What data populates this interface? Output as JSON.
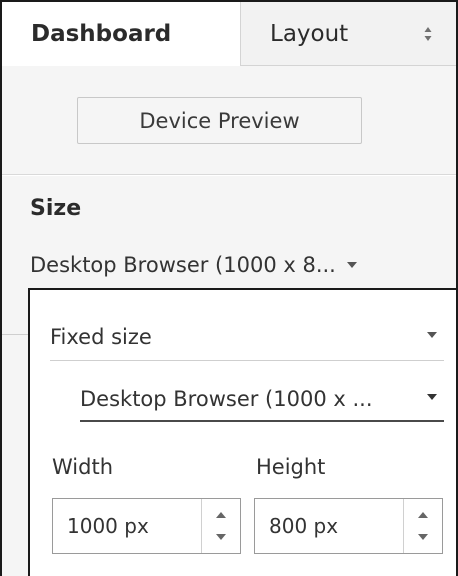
{
  "tabs": {
    "dashboard_label": "Dashboard",
    "layout_label": "Layout"
  },
  "device_preview": {
    "label": "Device Preview"
  },
  "size": {
    "title": "Size",
    "selected": "Desktop Browser (1000 x 8..."
  },
  "popup": {
    "mode_value": "Fixed size",
    "preset_value": "Desktop Browser (1000 x ...",
    "width_label": "Width",
    "height_label": "Height",
    "width_value": "1000 px",
    "height_value": "800 px"
  },
  "icons": {
    "sort": "sort-icon",
    "dropdown": "caret-down-icon",
    "spin_up": "chevron-up-icon",
    "spin_down": "chevron-down-icon"
  }
}
